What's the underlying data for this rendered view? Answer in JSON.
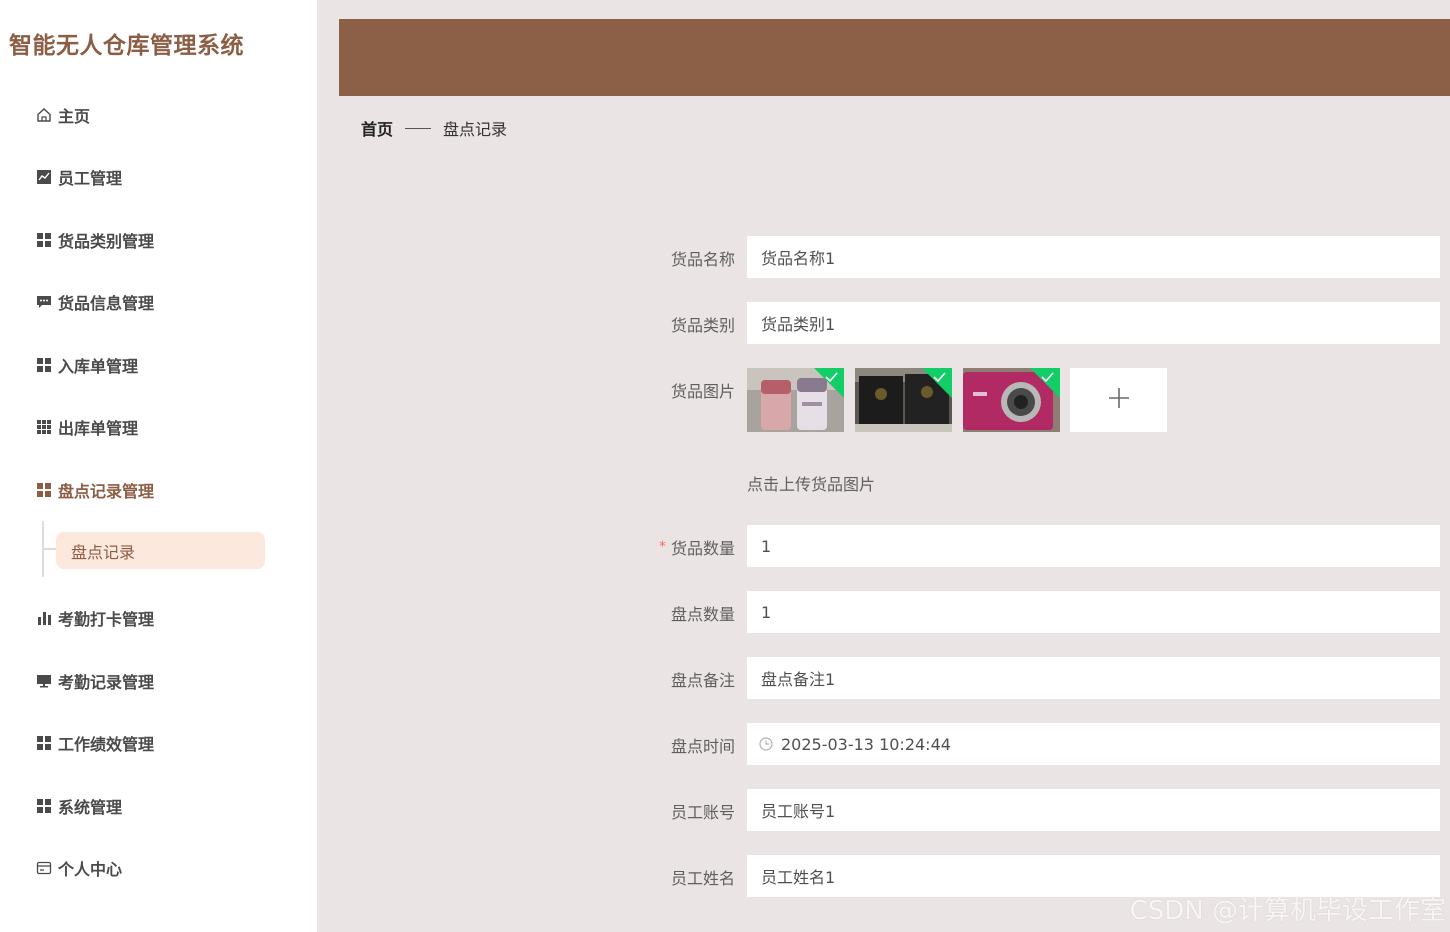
{
  "app": {
    "title": "智能无人仓库管理系统"
  },
  "sidebar": {
    "items": [
      {
        "label": "主页",
        "icon": "home-icon"
      },
      {
        "label": "员工管理",
        "icon": "chart-icon"
      },
      {
        "label": "货品类别管理",
        "icon": "grid-icon"
      },
      {
        "label": "货品信息管理",
        "icon": "message-icon"
      },
      {
        "label": "入库单管理",
        "icon": "grid-icon"
      },
      {
        "label": "出库单管理",
        "icon": "grid9-icon"
      },
      {
        "label": "盘点记录管理",
        "icon": "grid-icon",
        "active": true
      },
      {
        "label": "考勤打卡管理",
        "icon": "bar-chart-icon"
      },
      {
        "label": "考勤记录管理",
        "icon": "monitor-icon"
      },
      {
        "label": "工作绩效管理",
        "icon": "grid-icon"
      },
      {
        "label": "系统管理",
        "icon": "grid-icon"
      },
      {
        "label": "个人中心",
        "icon": "card-icon"
      }
    ],
    "sub_item": "盘点记录"
  },
  "breadcrumb": {
    "home": "首页",
    "current": "盘点记录"
  },
  "form": {
    "goods_name": {
      "label": "货品名称",
      "value": "货品名称1"
    },
    "goods_category": {
      "label": "货品类别",
      "value": "货品类别1"
    },
    "goods_image": {
      "label": "货品图片",
      "tip": "点击上传货品图片",
      "upload_icon": "plus-icon"
    },
    "goods_quantity": {
      "label": "货品数量",
      "value": "1",
      "required_mark": "*"
    },
    "check_quantity": {
      "label": "盘点数量",
      "value": "1"
    },
    "check_remark": {
      "label": "盘点备注",
      "value": "盘点备注1"
    },
    "check_time": {
      "label": "盘点时间",
      "value": "2025-03-13 10:24:44"
    },
    "employee_account": {
      "label": "员工账号",
      "value": "员工账号1"
    },
    "employee_name": {
      "label": "员工姓名",
      "value": "员工姓名1"
    }
  },
  "watermark": "CSDN @计算机毕设工作室",
  "colors": {
    "brand": "#8c5f47",
    "active_bg": "#fde8dd",
    "page_bg": "#ebe4e4",
    "success": "#13ce66"
  }
}
